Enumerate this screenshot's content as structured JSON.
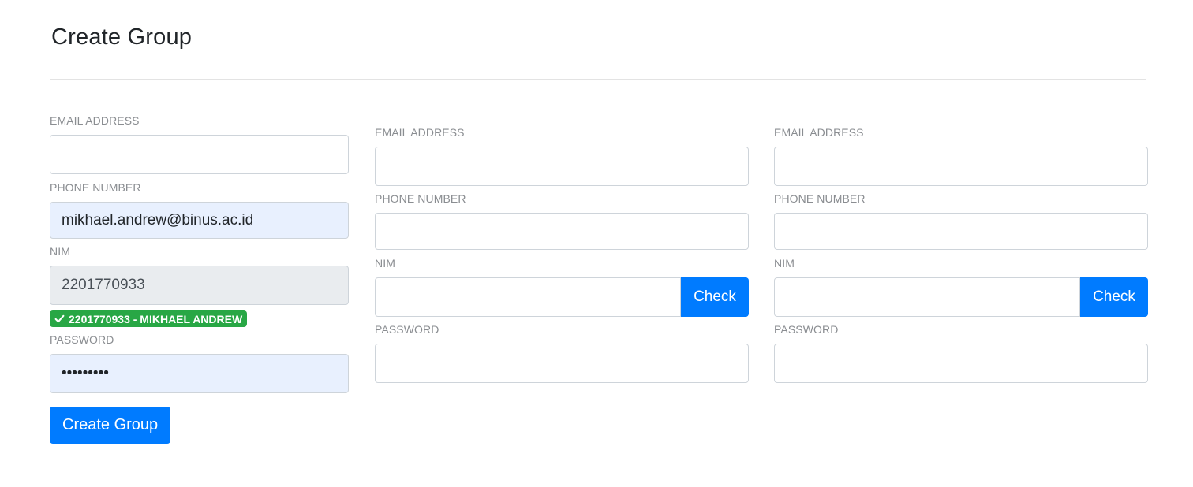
{
  "page": {
    "title": "Create Group"
  },
  "labels": {
    "email": "EMAIL ADDRESS",
    "phone": "PHONE NUMBER",
    "nim": "NIM",
    "password": "PASSWORD"
  },
  "member1": {
    "email_value": "",
    "phone_value": "mikhael.andrew@binus.ac.id",
    "nim_value": "2201770933",
    "verified_badge": "2201770933 - MIKHAEL ANDREW",
    "password_value": "•••••••••"
  },
  "member2": {
    "email_value": "",
    "phone_value": "",
    "nim_value": "",
    "password_value": ""
  },
  "member3": {
    "email_value": "",
    "phone_value": "",
    "nim_value": "",
    "password_value": ""
  },
  "buttons": {
    "check": "Check",
    "create_group": "Create Group"
  },
  "colors": {
    "primary": "#007bff",
    "success": "#28a745",
    "autofill": "#e8f0fe",
    "readonly": "#e9ecef"
  },
  "icons": {
    "badge_icon": "check-icon"
  }
}
